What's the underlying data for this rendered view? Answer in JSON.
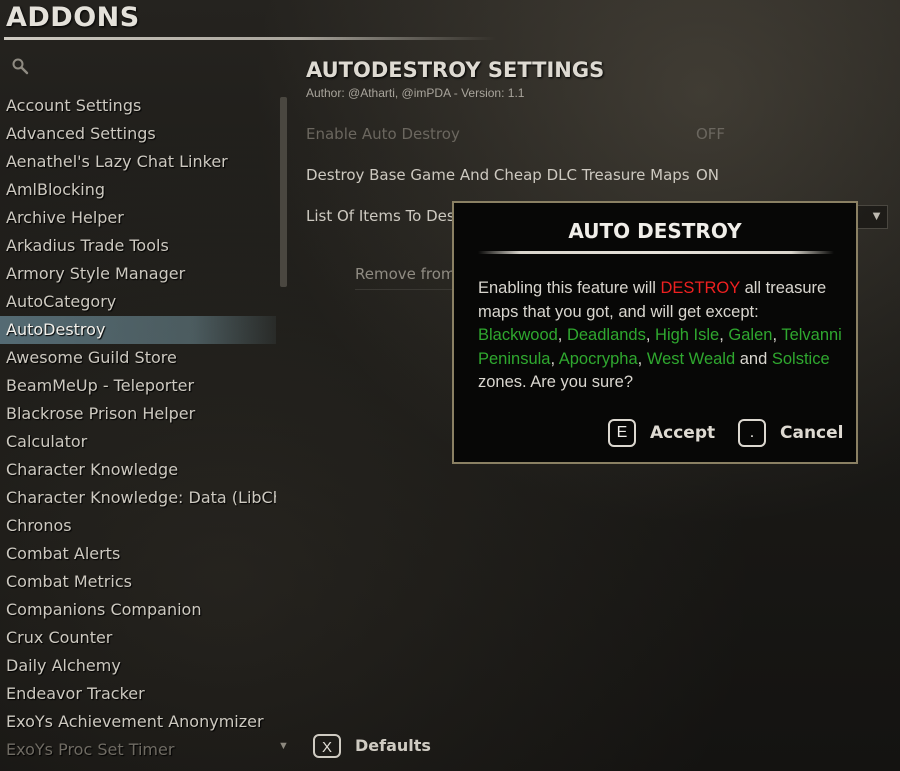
{
  "header": {
    "title": "ADDONS"
  },
  "search": {
    "icon": "search-icon"
  },
  "addon_list": [
    "Account Settings",
    "Advanced Settings",
    "Aenathel's Lazy Chat Linker",
    "AmlBlocking",
    "Archive Helper",
    "Arkadius Trade Tools",
    "Armory Style Manager",
    "AutoCategory",
    "AutoDestroy",
    "Awesome Guild Store",
    "BeamMeUp - Teleporter",
    "Blackrose Prison Helper",
    "Calculator",
    "Character Knowledge",
    "Character Knowledge: Data (LibCh...",
    "Chronos",
    "Combat Alerts",
    "Combat Metrics",
    "Companions Companion",
    "Crux Counter",
    "Daily Alchemy",
    "Endeavor Tracker",
    "ExoYs Achievement Anonymizer",
    "ExoYs Proc Set Timer"
  ],
  "selected_addon": "AutoDestroy",
  "settings": {
    "title": "AUTODESTROY SETTINGS",
    "author": "Author: @Atharti, @imPDA - Version: 1.1",
    "enable_label": "Enable Auto Destroy",
    "enable_value": "OFF",
    "maps_label": "Destroy Base Game And Cheap DLC Treasure Maps",
    "maps_value": "ON",
    "list_label": "List Of Items To Destroy:",
    "remove_label": "Remove from AutoDestroy"
  },
  "footer": {
    "defaults_key": "X",
    "defaults_label": "Defaults"
  },
  "dialog": {
    "title": "AUTO DESTROY",
    "text_1": "Enabling this feature will ",
    "text_destroy": "DESTROY",
    "text_2": " all treasure maps that you got, and will get except: ",
    "zone_1": "Blackwood",
    "sep_1": ", ",
    "zone_2": "Deadlands",
    "sep_2": ", ",
    "zone_3": "High Isle",
    "sep_3": ", ",
    "zone_4": "Galen",
    "sep_4": ", ",
    "zone_5": "Telvanni Peninsula",
    "sep_5": ", ",
    "zone_6": "Apocrypha",
    "sep_6": ", ",
    "zone_7": "West Weald",
    "and": " and ",
    "zone_8": "Solstice",
    "text_3": " zones. Are you sure?",
    "accept_key": "E",
    "accept_label": "Accept",
    "cancel_key": ".",
    "cancel_label": "Cancel"
  },
  "colors": {
    "accent_red": "#ee2020",
    "zone_green": "#2fa82f",
    "dialog_border": "#8a8063",
    "selection": "#5a737d"
  }
}
